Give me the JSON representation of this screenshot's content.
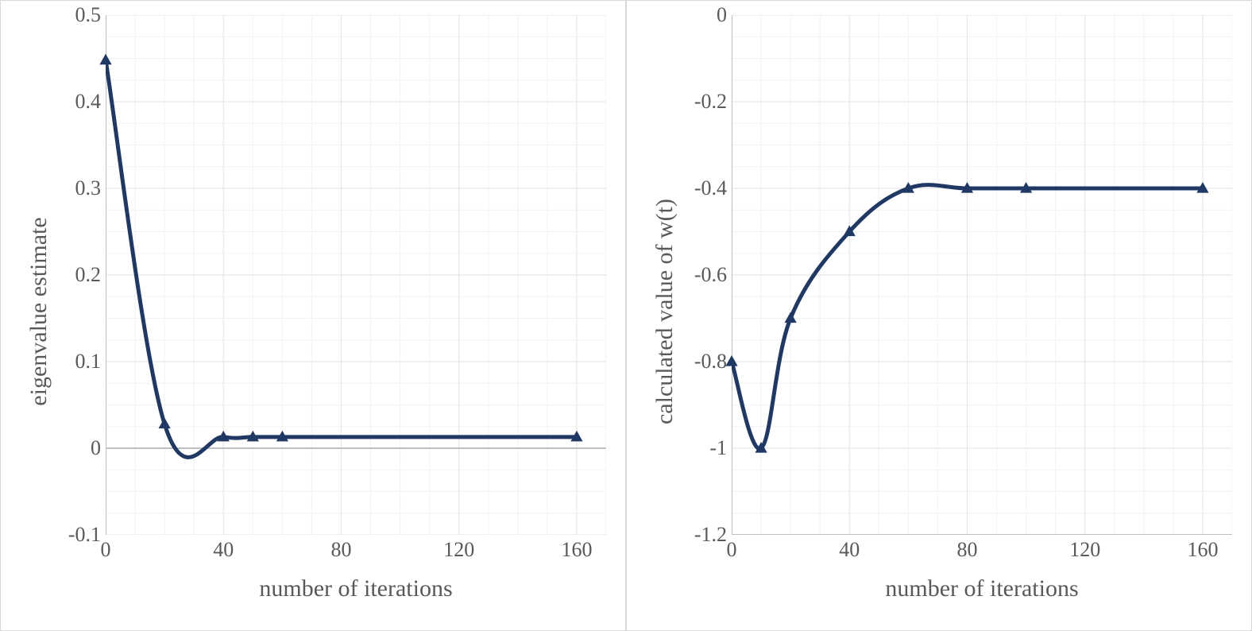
{
  "chart_data": [
    {
      "id": "left",
      "type": "line",
      "xlabel": "number of iterations",
      "ylabel": "eigenvalue estimate",
      "xlim": [
        0,
        170
      ],
      "ylim": [
        -0.1,
        0.5
      ],
      "xticks": [
        0,
        40,
        80,
        120,
        160
      ],
      "yticks": [
        -0.1,
        0,
        0.1,
        0.2,
        0.3,
        0.4,
        0.5
      ],
      "minor_grid_divs": {
        "x": 4,
        "y": 4
      },
      "series": [
        {
          "name": "eigenvalue-estimate",
          "color": "#1f3864",
          "smooth": true,
          "x": [
            0,
            20,
            40,
            50,
            60,
            160
          ],
          "values": [
            0.448,
            0.028,
            0.013,
            0.013,
            0.013,
            0.013
          ]
        }
      ]
    },
    {
      "id": "right",
      "type": "line",
      "xlabel": "number of iterations",
      "ylabel": "calculated value of w(t)",
      "xlim": [
        0,
        170
      ],
      "ylim": [
        -1.2,
        0
      ],
      "xticks": [
        0,
        40,
        80,
        120,
        160
      ],
      "yticks": [
        -1.2,
        -1.0,
        -0.8,
        -0.6,
        -0.4,
        -0.2,
        0
      ],
      "minor_grid_divs": {
        "x": 4,
        "y": 4
      },
      "series": [
        {
          "name": "w-of-t",
          "color": "#1f3864",
          "smooth": true,
          "x": [
            0,
            10,
            20,
            40,
            60,
            80,
            100,
            160
          ],
          "values": [
            -0.8,
            -1.0,
            -0.7,
            -0.5,
            -0.4,
            -0.4,
            -0.4,
            -0.4
          ]
        }
      ]
    }
  ]
}
